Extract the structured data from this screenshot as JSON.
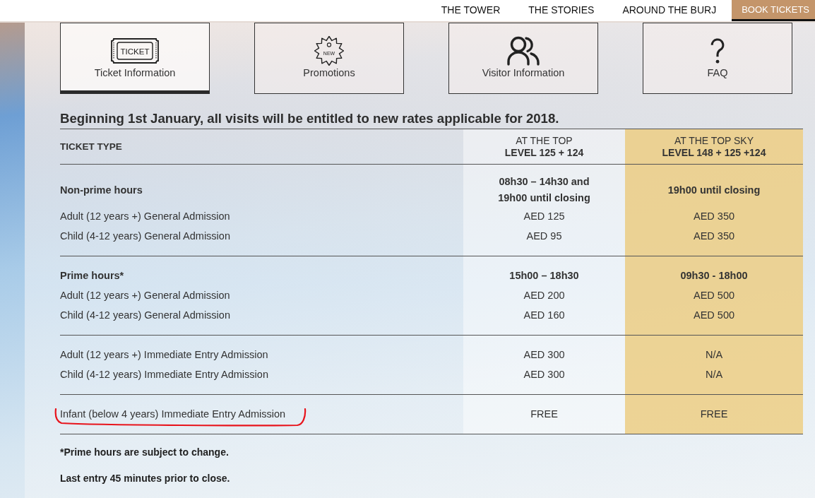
{
  "nav": {
    "links": [
      "THE TOWER",
      "THE STORIES",
      "AROUND THE BURJ"
    ],
    "book_button": "BOOK TICKETS"
  },
  "tabs": [
    {
      "kind": "ticket",
      "label": "Ticket Information",
      "icon_text": "TICKET",
      "selected": true
    },
    {
      "kind": "promo",
      "label": "Promotions",
      "icon_text": "NEW",
      "selected": false
    },
    {
      "kind": "visitor",
      "label": "Visitor Information",
      "selected": false
    },
    {
      "kind": "faq",
      "label": "FAQ",
      "selected": false
    }
  ],
  "notice": "Beginning 1st January, all visits will be entitled to new rates applicable for 2018.",
  "table": {
    "type_heading": "TICKET TYPE",
    "offers": [
      {
        "name": "AT THE TOP",
        "levels": "LEVEL 125 + 124",
        "highlighted": false
      },
      {
        "name": "AT THE TOP SKY",
        "levels": "LEVEL 148 + 125 +124",
        "highlighted": true
      }
    ],
    "groups": [
      {
        "rows": [
          {
            "kind": "hours",
            "label": "Non-prime hours",
            "values": [
              "08h30 – 14h30 and 19h00 until closing",
              "19h00 until closing"
            ],
            "marked": false
          },
          {
            "kind": "price",
            "label": "Adult (12 years +) General Admission",
            "values": [
              "AED 125",
              "AED 350"
            ],
            "marked": false
          },
          {
            "kind": "price",
            "label": "Child (4-12 years) General Admission",
            "values": [
              "AED 95",
              "AED 350"
            ],
            "marked": false
          }
        ]
      },
      {
        "rows": [
          {
            "kind": "hours",
            "label": "Prime hours*",
            "values": [
              "15h00 – 18h30",
              "09h30 - 18h00"
            ],
            "marked": false
          },
          {
            "kind": "price",
            "label": "Adult (12 years +) General Admission",
            "values": [
              "AED 200",
              "AED 500"
            ],
            "marked": false
          },
          {
            "kind": "price",
            "label": "Child (4-12 years) General Admission",
            "values": [
              "AED 160",
              "AED 500"
            ],
            "marked": false
          }
        ]
      },
      {
        "rows": [
          {
            "kind": "price",
            "label": "Adult (12 years +) Immediate Entry Admission",
            "values": [
              "AED 300",
              "N/A"
            ],
            "marked": false
          },
          {
            "kind": "price",
            "label": "Child (4-12 years) Immediate Entry Admission",
            "values": [
              "AED 300",
              "N/A"
            ],
            "marked": false
          }
        ]
      },
      {
        "rows": [
          {
            "kind": "price",
            "label": "Infant (below 4 years) Immediate Entry Admission",
            "values": [
              "FREE",
              "FREE"
            ],
            "marked": true
          }
        ]
      }
    ]
  },
  "footnotes": [
    "*Prime hours are subject to change.",
    "Last entry 45 minutes prior to close."
  ]
}
